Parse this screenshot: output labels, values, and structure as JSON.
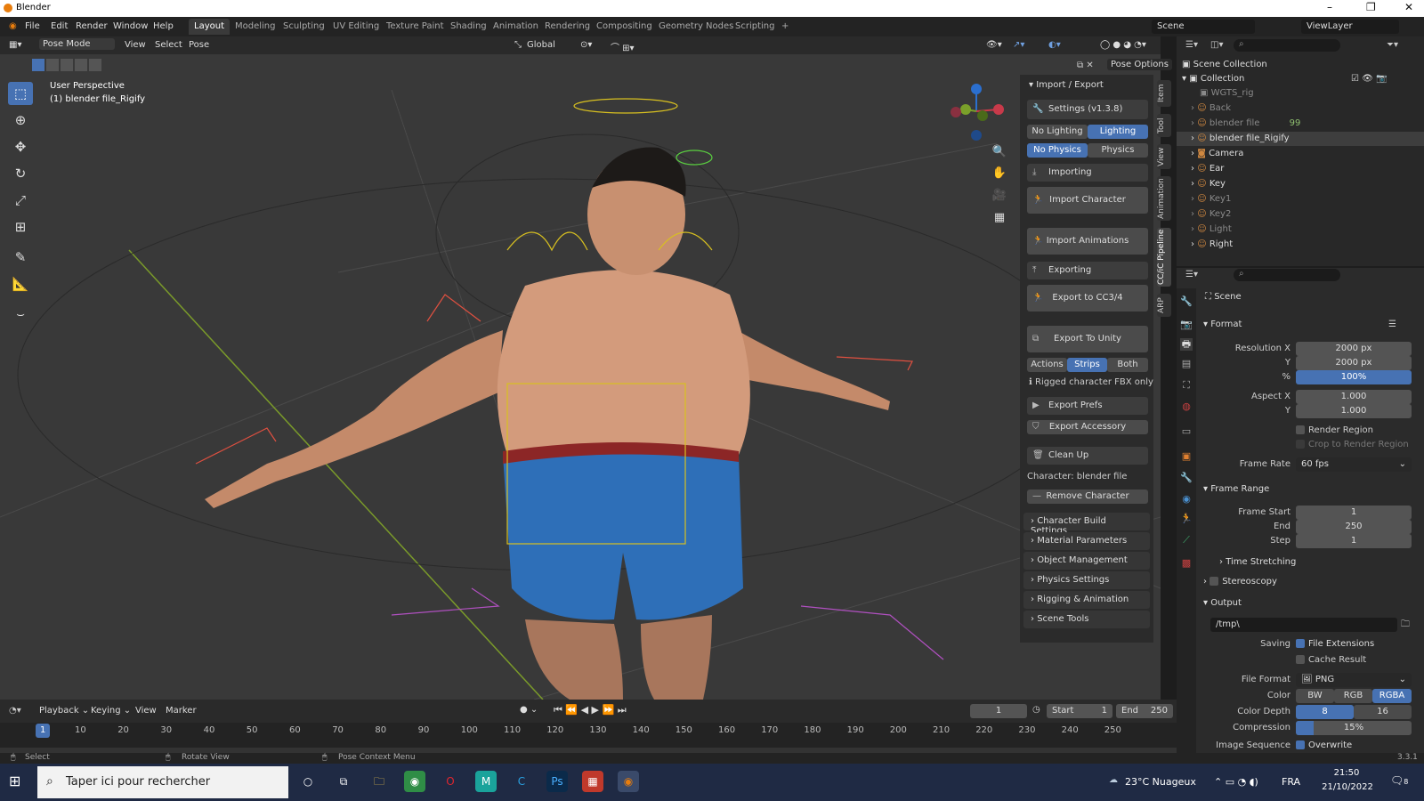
{
  "window": {
    "title": "Blender",
    "controls": [
      "–",
      "❐",
      "✕"
    ]
  },
  "menus": [
    "File",
    "Edit",
    "Render",
    "Window",
    "Help"
  ],
  "workspaces": [
    "Layout",
    "Modeling",
    "Sculpting",
    "UV Editing",
    "Texture Paint",
    "Shading",
    "Animation",
    "Rendering",
    "Compositing",
    "Geometry Nodes",
    "Scripting",
    "+"
  ],
  "active_workspace": "Layout",
  "scene": {
    "name": "Scene",
    "view_layer": "ViewLayer"
  },
  "viewport": {
    "mode": "Pose Mode",
    "menus": [
      "View",
      "Select",
      "Pose"
    ],
    "orientation": "Global",
    "overlay_title": "User Perspective",
    "overlay_object": "(1) blender file_Rigify",
    "pose_options": "Pose Options"
  },
  "cc_panel": {
    "header": "Import / Export",
    "settings": "Settings  (v1.3.8)",
    "lighting": [
      "No Lighting",
      "Lighting"
    ],
    "physics": [
      "No Physics",
      "Physics"
    ],
    "importing": "Importing",
    "import_character": "Import Character",
    "import_animations": "Import Animations",
    "exporting": "Exporting",
    "export_cc": "Export to CC3/4",
    "export_unity": "Export To Unity",
    "export_modes": [
      "Actions",
      "Strips",
      "Both"
    ],
    "fbx_note": "Rigged character FBX only",
    "export_prefs": "Export Prefs",
    "export_accessory": "Export Accessory",
    "clean_up": "Clean Up",
    "character": "Character: blender file",
    "remove_character": "Remove Character",
    "sections": [
      "Character Build Settings",
      "Material Parameters",
      "Object Management",
      "Physics Settings",
      "Rigging & Animation",
      "Scene Tools"
    ]
  },
  "vertical_tabs": [
    "Item",
    "Tool",
    "View",
    "Animation",
    "CC/iC Pipeline",
    "ARP"
  ],
  "outliner": {
    "root": "Scene Collection",
    "collection": "Collection",
    "items": [
      {
        "name": "WGTS_rig",
        "dim": true
      },
      {
        "name": "Back",
        "dim": true
      },
      {
        "name": "blender file",
        "dim": true,
        "extra": "99"
      },
      {
        "name": "blender file_Rigify",
        "dim": false
      },
      {
        "name": "Camera",
        "dim": false
      },
      {
        "name": "Ear",
        "dim": false
      },
      {
        "name": "Key",
        "dim": false
      },
      {
        "name": "Key1",
        "dim": true
      },
      {
        "name": "Key2",
        "dim": true
      },
      {
        "name": "Light",
        "dim": true
      },
      {
        "name": "Right",
        "dim": false
      }
    ]
  },
  "properties": {
    "scene": "Scene",
    "format": "Format",
    "resolution_x_label": "Resolution X",
    "resolution_x": "2000 px",
    "y_label": "Y",
    "resolution_y": "2000 px",
    "pct_label": "%",
    "resolution_pct": "100%",
    "aspect_x_label": "Aspect X",
    "aspect_x": "1.000",
    "aspect_y": "1.000",
    "render_region": "Render Region",
    "crop": "Crop to Render Region",
    "frame_rate_label": "Frame Rate",
    "frame_rate": "60 fps",
    "frame_range": "Frame Range",
    "frame_start_label": "Frame Start",
    "frame_start": "1",
    "end_label": "End",
    "frame_end": "250",
    "step_label": "Step",
    "step": "1",
    "time_stretching": "Time Stretching",
    "stereoscopy": "Stereoscopy",
    "output": "Output",
    "output_path": "/tmp\\",
    "saving_label": "Saving",
    "file_extensions": "File Extensions",
    "cache_result": "Cache Result",
    "file_format_label": "File Format",
    "file_format": "PNG",
    "color_label": "Color",
    "color_modes": [
      "BW",
      "RGB",
      "RGBA"
    ],
    "depth_label": "Color Depth",
    "depth_modes": [
      "8",
      "16"
    ],
    "compression_label": "Compression",
    "compression": "15%",
    "compression_fraction": 0.15,
    "image_sequence_label": "Image Sequence",
    "overwrite": "Overwrite"
  },
  "timeline": {
    "menus": [
      "Playback",
      "Keying",
      "View",
      "Marker"
    ],
    "current_frame": "1",
    "start_label": "Start",
    "start": "1",
    "end_label": "End",
    "end": "250",
    "ticks": [
      "1",
      "10",
      "20",
      "30",
      "40",
      "50",
      "60",
      "70",
      "80",
      "90",
      "100",
      "110",
      "120",
      "130",
      "140",
      "150",
      "160",
      "170",
      "180",
      "190",
      "200",
      "210",
      "220",
      "230",
      "240",
      "250"
    ]
  },
  "status": {
    "select": "Select",
    "rotate": "Rotate View",
    "context": "Pose Context Menu",
    "version": "3.3.1"
  },
  "taskbar": {
    "search": "Taper ici pour rechercher",
    "weather": "23°C  Nuageux",
    "lang": "FRA",
    "time": "21:50",
    "date": "21/10/2022",
    "notif": "8"
  }
}
